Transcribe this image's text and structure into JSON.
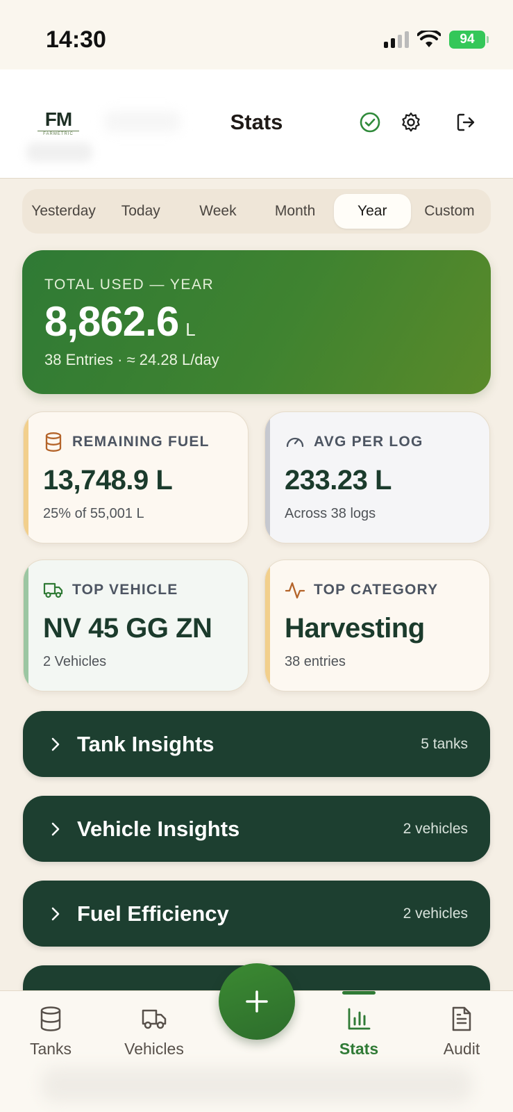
{
  "status_bar": {
    "time": "14:30",
    "battery": "94"
  },
  "header": {
    "title": "Stats",
    "logo_text": "FM",
    "logo_subtext": "FARMETRIC"
  },
  "periods": [
    "Yesterday",
    "Today",
    "Week",
    "Month",
    "Year",
    "Custom"
  ],
  "active_period": "Year",
  "hero": {
    "label": "TOTAL USED — YEAR",
    "value": "8,862.6",
    "unit": "L",
    "sub": "38 Entries · ≈ 24.28 L/day"
  },
  "cards": {
    "remaining": {
      "label": "REMAINING FUEL",
      "value": "13,748.9 L",
      "sub": "25% of 55,001 L",
      "icon": "database-icon"
    },
    "avg": {
      "label": "AVG PER LOG",
      "value": "233.23 L",
      "sub": "Across 38 logs",
      "icon": "gauge-icon"
    },
    "vehicle": {
      "label": "TOP VEHICLE",
      "value": "NV 45 GG ZN",
      "sub": "2 Vehicles",
      "icon": "truck-icon"
    },
    "category": {
      "label": "TOP CATEGORY",
      "value": "Harvesting",
      "sub": "38 entries",
      "icon": "activity-icon"
    }
  },
  "sections": [
    {
      "title": "Tank Insights",
      "count": "5 tanks"
    },
    {
      "title": "Vehicle Insights",
      "count": "2 vehicles"
    },
    {
      "title": "Fuel Efficiency",
      "count": "2 vehicles"
    }
  ],
  "nav": {
    "tanks": "Tanks",
    "vehicles": "Vehicles",
    "stats": "Stats",
    "audit": "Audit"
  },
  "colors": {
    "brand_green": "#2f7a35",
    "section_dark": "#1d3f30",
    "background": "#f5efe5"
  }
}
